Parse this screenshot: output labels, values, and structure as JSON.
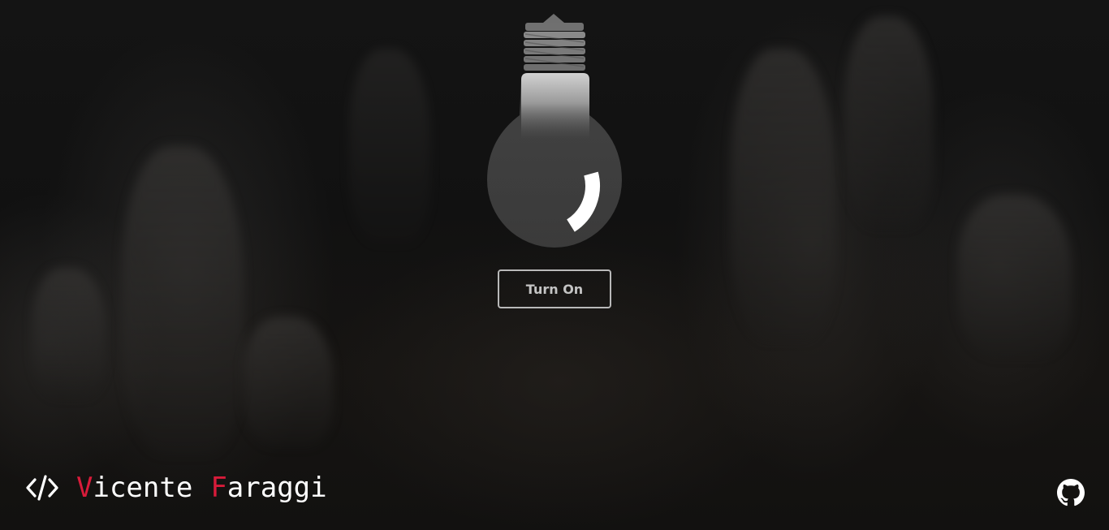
{
  "bulb": {
    "state": "off"
  },
  "toggle_button": {
    "label": "Turn On"
  },
  "brand": {
    "icon": "code-icon",
    "first_name_initial": "V",
    "first_name_rest": "icente",
    "last_name_initial": "F",
    "last_name_rest": "araggi",
    "accent_color": "#d81b3a"
  },
  "footer": {
    "github_icon": "github-icon"
  }
}
